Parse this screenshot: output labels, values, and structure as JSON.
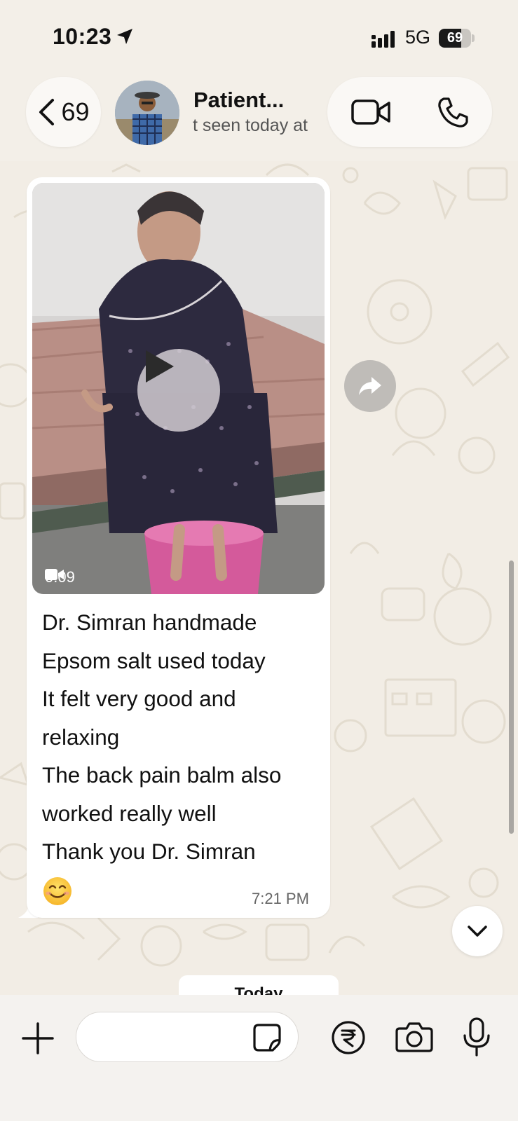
{
  "status_bar": {
    "time": "10:23",
    "network": "5G",
    "battery_level": "69",
    "battery_fraction": 0.69,
    "icons": [
      "location-arrow-icon",
      "signal-icon",
      "battery-icon"
    ]
  },
  "header": {
    "back_count": "69",
    "contact_name": "Patient...",
    "contact_status": "Last seen today at",
    "icons": [
      "chevron-left-icon",
      "video-call-icon",
      "phone-icon"
    ]
  },
  "message": {
    "video_duration": "0:09",
    "lines": [
      "Dr. Simran handmade",
      "Epsom salt used today",
      "It felt very good and",
      "relaxing",
      "The back pain balm also",
      "worked really well",
      "Thank you Dr. Simran"
    ],
    "emoji": "😊",
    "time": "7:21 PM",
    "icons": [
      "play-icon",
      "video-camera-icon",
      "smile-emoji-icon"
    ]
  },
  "date_chip": "Today",
  "input_bar": {
    "placeholder": "",
    "icons": [
      "plus-icon",
      "sticker-icon",
      "rupee-payment-icon",
      "camera-icon",
      "microphone-icon"
    ]
  },
  "colors": {
    "background": "#f3efe8",
    "bubble": "#ffffff",
    "forward_button": "#bfbcb8",
    "text_primary": "#111111",
    "text_secondary": "#666666"
  }
}
